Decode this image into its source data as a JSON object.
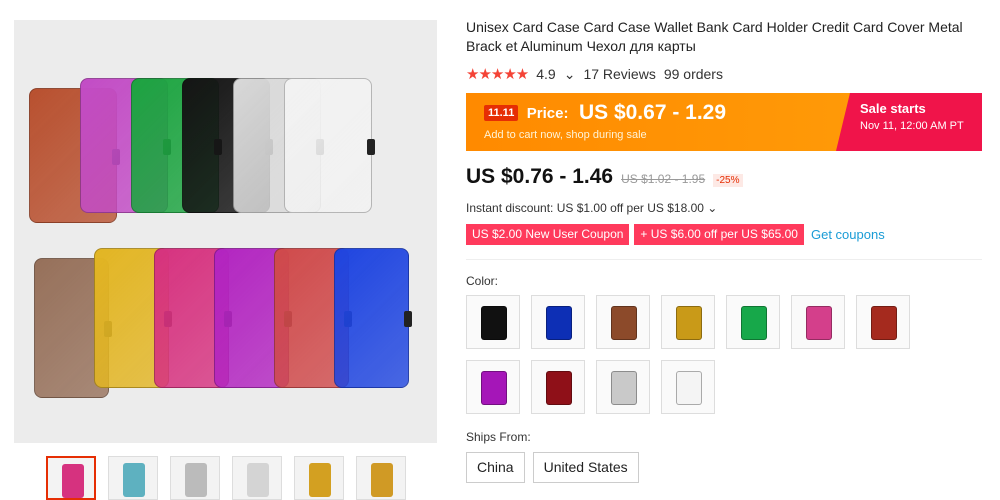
{
  "product": {
    "title": "Unisex Card Case Card Case Wallet Bank Card Holder Credit Card Cover Metal Brack et Aluminum Чехол для карты",
    "rating": "4.9",
    "reviews": "17 Reviews",
    "orders": "99 orders"
  },
  "sale_banner": {
    "badge": "11.11",
    "price_label": "Price:",
    "price": "US $0.67 - 1.29",
    "subtitle": "Add to cart now, shop during sale",
    "starts_title": "Sale starts",
    "starts_date": "Nov 11, 12:00 AM PT"
  },
  "pricing": {
    "current": "US $0.76 - 1.46",
    "original": "US $1.02 - 1.95",
    "discount": "-25%",
    "instant_discount": "Instant discount: US $1.00 off per US $18.00 ⌄"
  },
  "coupons": {
    "new_user": "US $2.00 New User Coupon",
    "offer": "+ US $6.00 off per US $65.00",
    "get_link": "Get coupons"
  },
  "color": {
    "label": "Color:",
    "options": [
      "#111111",
      "#0d2fb5",
      "#8c4a2a",
      "#c99a18",
      "#17a84a",
      "#d43f8b",
      "#a52a1e",
      "#a516b8",
      "#8f1018",
      "#c9c9c9",
      "#f4f4f4"
    ]
  },
  "ships_from": {
    "label": "Ships From:",
    "options": [
      "China",
      "United States"
    ]
  },
  "gallery": {
    "case_colors_top": [
      "#b8502f",
      "#c24cc5",
      "#1da441",
      "#151515",
      "#d9d9d9",
      "#f2f2f2"
    ],
    "case_colors_bottom": [
      "#96705a",
      "#e2b523",
      "#d6327f",
      "#b225c0",
      "#cf4a4b",
      "#1f45e0"
    ],
    "thumbnail_colors": [
      "#d6327f",
      "#5eb1c0",
      "#bbbbbb",
      "#d4d4d4",
      "#d3a021",
      "#d09a25"
    ]
  }
}
